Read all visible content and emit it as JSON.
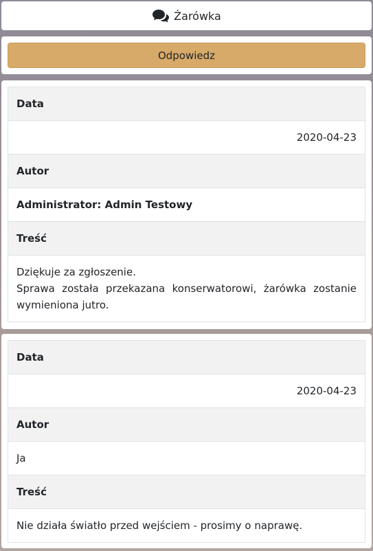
{
  "header": {
    "icon": "comments-icon",
    "title": "Żarówka"
  },
  "actions": {
    "reply_label": "Odpowiedz",
    "reply_color": "#d7aa69"
  },
  "messages": [
    {
      "date_label": "Data",
      "date": "2020-04-23",
      "author_label": "Autor",
      "author": "Administrator: Admin Testowy",
      "content_label": "Treść",
      "content_lines": [
        "Dziękuje za zgłoszenie.",
        "Sprawa została przekazana konserwatorowi, żarówka zostanie wymieniona jutro."
      ]
    },
    {
      "date_label": "Data",
      "date": "2020-04-23",
      "author_label": "Autor",
      "author": "Ja",
      "content_label": "Treść",
      "content_lines": [
        "Nie działa światło przed wejściem - prosimy o naprawę."
      ]
    }
  ]
}
